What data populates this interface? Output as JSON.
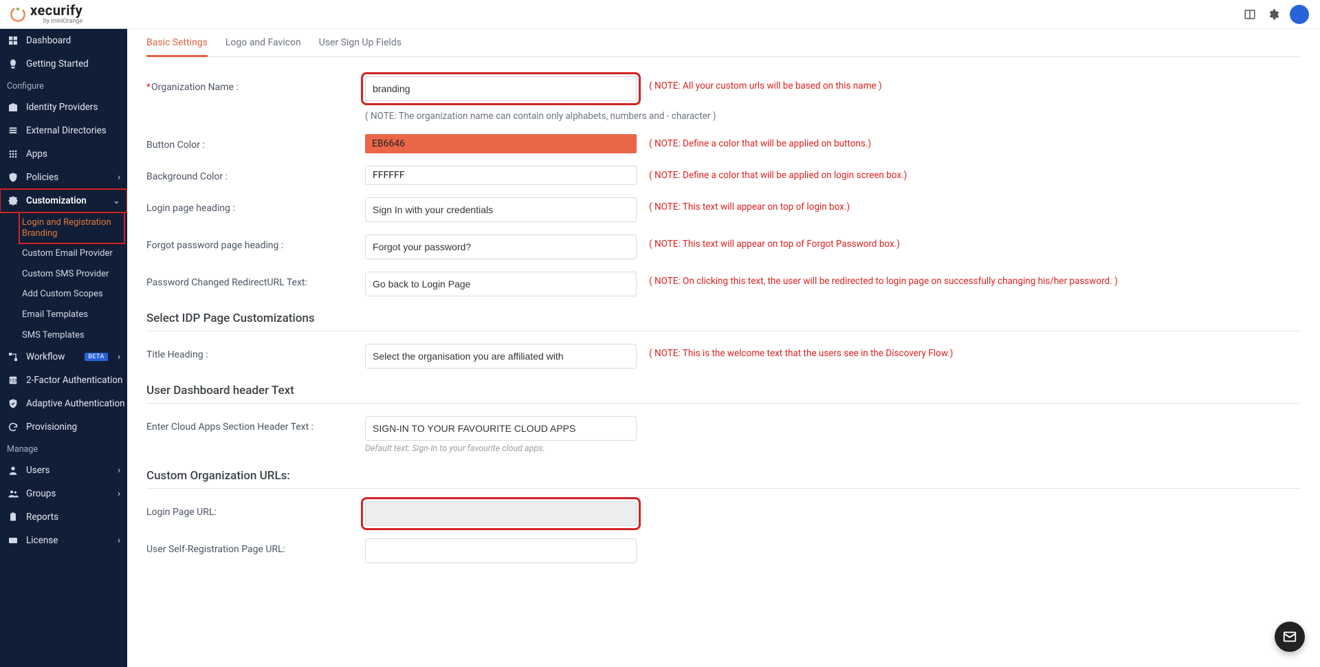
{
  "brand": {
    "name": "xecurify",
    "sub": "by miniOrange"
  },
  "topbar": {
    "panel_icon": "panel-icon",
    "gear_icon": "gear-icon",
    "avatar": "avatar"
  },
  "sidebar": {
    "sec_configure": "Configure",
    "sec_manage": "Manage",
    "items": {
      "dashboard": "Dashboard",
      "getting_started": "Getting Started",
      "identity_providers": "Identity Providers",
      "external_directories": "External Directories",
      "apps": "Apps",
      "policies": "Policies",
      "customization": "Customization",
      "workflow": "Workflow",
      "two_factor": "2-Factor Authentication",
      "adaptive_auth": "Adaptive Authentication",
      "provisioning": "Provisioning",
      "users": "Users",
      "groups": "Groups",
      "reports": "Reports",
      "license": "License"
    },
    "sub_customization": {
      "login_branding": "Login and Registration Branding",
      "email_provider": "Custom Email Provider",
      "sms_provider": "Custom SMS Provider",
      "add_scopes": "Add Custom Scopes",
      "email_templates": "Email Templates",
      "sms_templates": "SMS Templates"
    },
    "beta": "BETA"
  },
  "tabs": {
    "basic": "Basic Settings",
    "logo": "Logo and Favicon",
    "signup": "User Sign Up Fields"
  },
  "form": {
    "org_name_label": "Organization Name :",
    "org_name_value": "branding",
    "org_name_note": "( NOTE: All your custom urls will be based on this name )",
    "org_name_subnote": "( NOTE: The organization name can contain only alphabets, numbers and - character )",
    "button_color_label": "Button Color :",
    "button_color_value": "EB6646",
    "button_color_hex": "#EB6646",
    "button_color_note": "( NOTE: Define a color that will be applied on buttons.)",
    "bg_color_label": "Background Color :",
    "bg_color_value": "FFFFFF",
    "bg_color_hex": "#FFFFFF",
    "bg_color_note": "( NOTE: Define a color that will be applied on login screen box.)",
    "login_heading_label": "Login page heading :",
    "login_heading_value": "Sign In with your credentials",
    "login_heading_note": "( NOTE: This text will appear on top of login box.)",
    "forgot_heading_label": "Forgot password page heading :",
    "forgot_heading_value": "Forgot your password?",
    "forgot_heading_note": "( NOTE: This text will appear on top of Forgot Password box.)",
    "pwd_redirect_label": "Password Changed RedirectURL Text:",
    "pwd_redirect_value": "Go back to Login Page",
    "pwd_redirect_note": "( NOTE: On clicking this text, the user will be redirected to login page on successfully changing his/her password. )",
    "idp_section": "Select IDP Page Customizations",
    "title_heading_label": "Title Heading :",
    "title_heading_value": "Select the organisation you are affiliated with",
    "title_heading_note": "( NOTE: This is the welcome text that the users see in the Discovery Flow.)",
    "dashboard_section": "User Dashboard header Text",
    "cloud_header_label": "Enter Cloud Apps Section Header Text :",
    "cloud_header_value": "SIGN-IN TO YOUR FAVOURITE CLOUD APPS",
    "cloud_header_subnote": "Default text: Sign-In to your favourite cloud apps.",
    "urls_section": "Custom Organization URLs:",
    "login_url_label": "Login Page URL:",
    "self_reg_url_label": "User Self-Registration Page URL:"
  }
}
